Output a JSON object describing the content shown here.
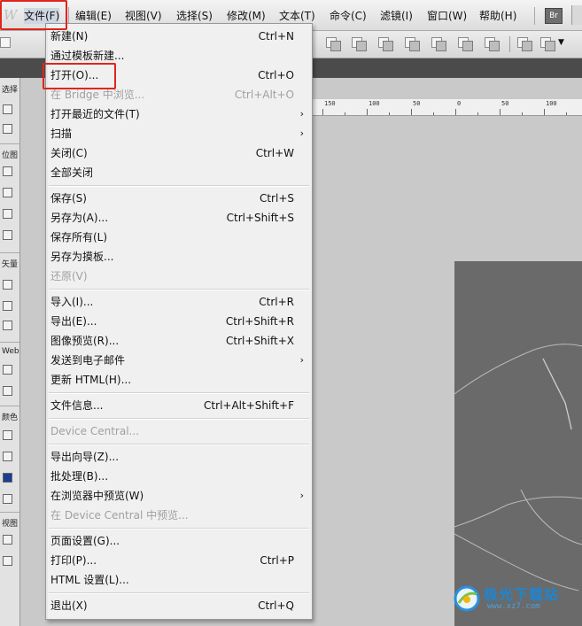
{
  "menubar": {
    "logo": "W",
    "items": [
      "文件(F)",
      "编辑(E)",
      "视图(V)",
      "选择(S)",
      "修改(M)",
      "文本(T)",
      "命令(C)",
      "滤镜(I)",
      "窗口(W)",
      "帮助(H)"
    ],
    "bridge": "Br"
  },
  "ruler": {
    "labels": [
      "150",
      "100",
      "50",
      "0",
      "50",
      "100"
    ]
  },
  "left_panel": {
    "labels": [
      "选择",
      "位图",
      "矢量",
      "Web",
      "颜色",
      "视图"
    ]
  },
  "file_menu": {
    "items": [
      {
        "label": "新建(N)",
        "shortcut": "Ctrl+N"
      },
      {
        "label": "通过模板新建...",
        "shortcut": ""
      },
      {
        "label": "打开(O)...",
        "shortcut": "Ctrl+O"
      },
      {
        "label": "在 Bridge 中浏览...",
        "shortcut": "Ctrl+Alt+O"
      },
      {
        "label": "打开最近的文件(T)",
        "shortcut": ""
      },
      {
        "label": "扫描",
        "shortcut": ""
      },
      {
        "label": "关闭(C)",
        "shortcut": "Ctrl+W"
      },
      {
        "label": "全部关闭",
        "shortcut": ""
      },
      {
        "label": "保存(S)",
        "shortcut": "Ctrl+S"
      },
      {
        "label": "另存为(A)...",
        "shortcut": "Ctrl+Shift+S"
      },
      {
        "label": "保存所有(L)",
        "shortcut": ""
      },
      {
        "label": "另存为摸板...",
        "shortcut": ""
      },
      {
        "label": "还原(V)",
        "shortcut": ""
      },
      {
        "label": "导入(I)...",
        "shortcut": "Ctrl+R"
      },
      {
        "label": "导出(E)...",
        "shortcut": "Ctrl+Shift+R"
      },
      {
        "label": "图像预览(R)...",
        "shortcut": "Ctrl+Shift+X"
      },
      {
        "label": "发送到电子邮件",
        "shortcut": ""
      },
      {
        "label": "更新 HTML(H)...",
        "shortcut": ""
      },
      {
        "label": "文件信息...",
        "shortcut": "Ctrl+Alt+Shift+F"
      },
      {
        "label": "Device Central...",
        "shortcut": ""
      },
      {
        "label": "导出向导(Z)...",
        "shortcut": ""
      },
      {
        "label": "批处理(B)...",
        "shortcut": ""
      },
      {
        "label": "在浏览器中预览(W)",
        "shortcut": ""
      },
      {
        "label": "在 Device Central 中预览...",
        "shortcut": ""
      },
      {
        "label": "页面设置(G)...",
        "shortcut": ""
      },
      {
        "label": "打印(P)...",
        "shortcut": "Ctrl+P"
      },
      {
        "label": "HTML 设置(L)...",
        "shortcut": ""
      },
      {
        "label": "退出(X)",
        "shortcut": "Ctrl+Q"
      }
    ],
    "submenu_arrow": "›"
  },
  "watermark": {
    "title": "极光下载站",
    "url": "www.xz7.com"
  },
  "colors": {
    "highlight": "#e0251b",
    "menu_bg": "#f0f0f0",
    "canvas": "#6a6a6a"
  }
}
